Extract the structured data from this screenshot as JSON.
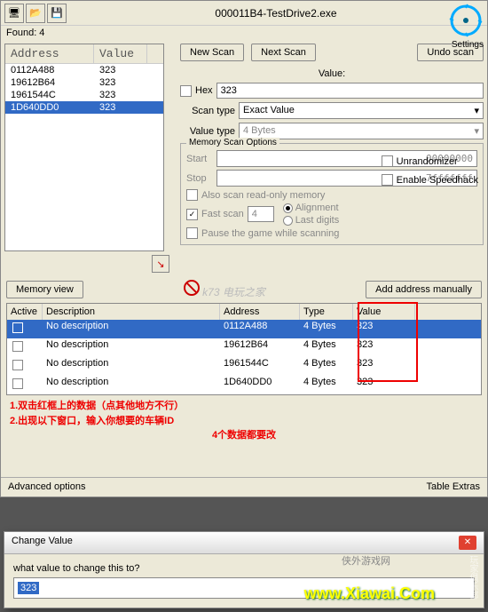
{
  "process_name": "000011B4-TestDrive2.exe",
  "settings_label": "Settings",
  "found_label": "Found: 4",
  "columns": {
    "address": "Address",
    "value": "Value"
  },
  "address_list": [
    {
      "addr": "0112A488",
      "val": "323",
      "selected": false
    },
    {
      "addr": "19612B64",
      "val": "323",
      "selected": false
    },
    {
      "addr": "1961544C",
      "val": "323",
      "selected": false
    },
    {
      "addr": "1D640DD0",
      "val": "323",
      "selected": true
    }
  ],
  "buttons": {
    "new_scan": "New Scan",
    "next_scan": "Next Scan",
    "undo_scan": "Undo scan",
    "memory_view": "Memory view",
    "add_manually": "Add address manually",
    "advanced": "Advanced options",
    "table_extras": "Table Extras"
  },
  "labels": {
    "value": "Value:",
    "hex": "Hex",
    "scan_type": "Scan type",
    "value_type": "Value type",
    "memory_scan_options": "Memory Scan Options",
    "start": "Start",
    "stop": "Stop",
    "also_scan_readonly": "Also scan read-only memory",
    "fast_scan": "Fast scan",
    "alignment": "Alignment",
    "last_digits": "Last digits",
    "pause_game": "Pause the game while scanning",
    "unrandomizer": "Unrandomizer",
    "enable_speedhack": "Enable Speedhack"
  },
  "inputs": {
    "value": "323",
    "scan_type": "Exact Value",
    "value_type": "4 Bytes",
    "start": "00000000",
    "stop": "7fffffff",
    "fast_scan_val": "4"
  },
  "table_columns": {
    "active": "Active",
    "description": "Description",
    "address": "Address",
    "type": "Type",
    "value": "Value"
  },
  "cheat_table": [
    {
      "desc": "No description",
      "addr": "0112A488",
      "type": "4 Bytes",
      "val": "323",
      "selected": true
    },
    {
      "desc": "No description",
      "addr": "19612B64",
      "type": "4 Bytes",
      "val": "323",
      "selected": false
    },
    {
      "desc": "No description",
      "addr": "1961544C",
      "type": "4 Bytes",
      "val": "323",
      "selected": false
    },
    {
      "desc": "No description",
      "addr": "1D640DD0",
      "type": "4 Bytes",
      "val": "323",
      "selected": false
    }
  ],
  "annotations": {
    "line1": "1.双击红框上的数据（点其他地方不行）",
    "line2": "2.出现以下窗口，输入你想要的车辆ID",
    "line3": "4个数据都要改"
  },
  "dialog": {
    "title": "Change Value",
    "prompt": "what value to change this to?",
    "value": "323"
  },
  "watermark_center": "k73 电玩之家",
  "watermark2": "侠外游戏网",
  "url": "www.Xiawai.Com",
  "corner": "玩家俱乐部"
}
